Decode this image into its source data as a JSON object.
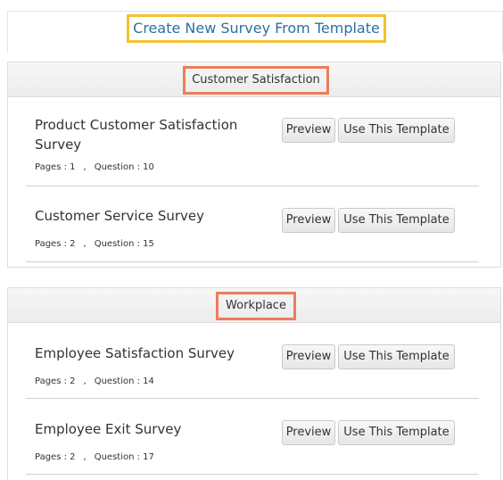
{
  "header": {
    "title": "Create New Survey From Template"
  },
  "categories": [
    {
      "name": "Customer Satisfaction",
      "surveys": [
        {
          "name": "Product Customer Satisfaction Survey",
          "pages": "Pages : 1",
          "questions": "Question : 10"
        },
        {
          "name": "Customer Service Survey",
          "pages": "Pages : 2",
          "questions": "Question : 15"
        }
      ]
    },
    {
      "name": "Workplace",
      "surveys": [
        {
          "name": "Employee Satisfaction Survey",
          "pages": "Pages : 2",
          "questions": "Question : 14"
        },
        {
          "name": "Employee Exit Survey",
          "pages": "Pages : 2",
          "questions": "Question : 17"
        }
      ]
    }
  ],
  "buttons": {
    "preview": "Preview",
    "use_template": "Use This Template"
  },
  "separator": ","
}
